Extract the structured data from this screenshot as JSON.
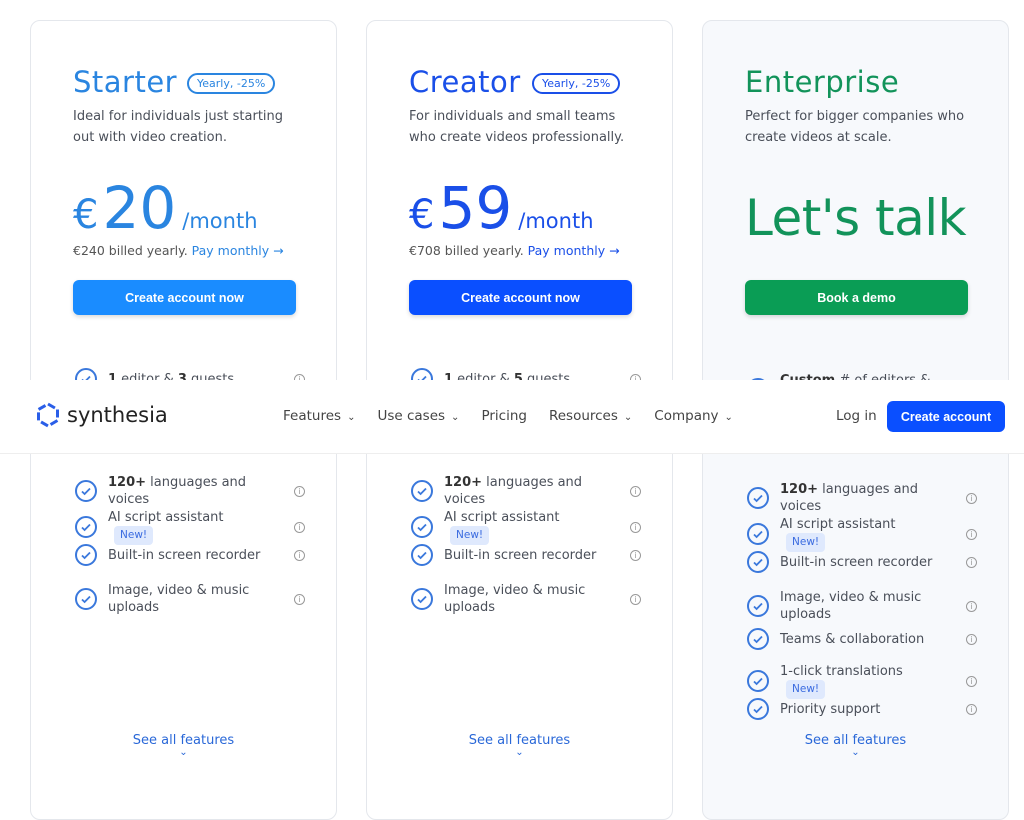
{
  "plans": [
    {
      "name": "Starter",
      "badge": "Yearly, -25%",
      "desc": "Ideal for individuals just starting out with video creation.",
      "currency": "€",
      "amount": "20",
      "period": "/month",
      "billed": "€240 billed yearly.",
      "pay_monthly": "Pay monthly →",
      "cta": "Create account now",
      "see_all": "See all features",
      "color": "#2a85e0",
      "btn": "#1a8cff",
      "features": [
        [
          {
            "t": "1",
            "b": true
          },
          {
            "t": " editor & "
          },
          {
            "t": "3",
            "b": true
          },
          {
            "t": " guests"
          }
        ],
        [
          {
            "t": "120+",
            "b": true
          },
          {
            "t": " languages and voices"
          }
        ],
        [
          {
            "t": "AI script assistant"
          }
        ],
        [
          {
            "t": "Built-in screen recorder"
          }
        ],
        [
          {
            "t": "Image, video & music uploads"
          }
        ]
      ],
      "new_flags": [
        false,
        false,
        true,
        false,
        false
      ]
    },
    {
      "name": "Creator",
      "badge": "Yearly, -25%",
      "desc": "For individuals and small teams who create videos professionally.",
      "currency": "€",
      "amount": "59",
      "period": "/month",
      "billed": "€708 billed yearly.",
      "pay_monthly": "Pay monthly →",
      "cta": "Create account now",
      "see_all": "See all features",
      "color": "#1a4fe8",
      "btn": "#0a4fff",
      "features": [
        [
          {
            "t": "1",
            "b": true
          },
          {
            "t": " editor & "
          },
          {
            "t": "5",
            "b": true
          },
          {
            "t": " guests"
          }
        ],
        [
          {
            "t": "120+",
            "b": true
          },
          {
            "t": " languages and voices"
          }
        ],
        [
          {
            "t": "AI script assistant"
          }
        ],
        [
          {
            "t": "Built-in screen recorder"
          }
        ],
        [
          {
            "t": "Image, video & music uploads"
          }
        ]
      ],
      "new_flags": [
        false,
        false,
        true,
        false,
        false
      ]
    },
    {
      "name": "Enterprise",
      "desc": "Perfect for bigger companies who create videos at scale.",
      "talk": "Let's talk",
      "cta": "Book a demo",
      "see_all": "See all features",
      "color": "#12935a",
      "btn": "#0a9d55",
      "features": [
        [
          {
            "t": "Custom",
            "b": true
          },
          {
            "t": " # of editors & guests"
          }
        ],
        [
          {
            "t": "120+",
            "b": true
          },
          {
            "t": " languages and voices"
          }
        ],
        [
          {
            "t": "AI script assistant"
          }
        ],
        [
          {
            "t": "Built-in screen recorder"
          }
        ],
        [
          {
            "t": "Image, video & music uploads"
          }
        ],
        [
          {
            "t": "Teams & collaboration"
          }
        ],
        [
          {
            "t": "1-click translations"
          }
        ],
        [
          {
            "t": "Priority support"
          }
        ]
      ],
      "new_flags": [
        false,
        false,
        true,
        false,
        false,
        false,
        true,
        false
      ]
    }
  ],
  "new_label": "New!",
  "nav": {
    "logo": "synthesia",
    "items": [
      "Features",
      "Use cases",
      "Pricing",
      "Resources",
      "Company"
    ],
    "has_dropdown": [
      true,
      true,
      false,
      true,
      true
    ],
    "login": "Log in",
    "cta": "Create account",
    "accent": "#0a4fff"
  }
}
